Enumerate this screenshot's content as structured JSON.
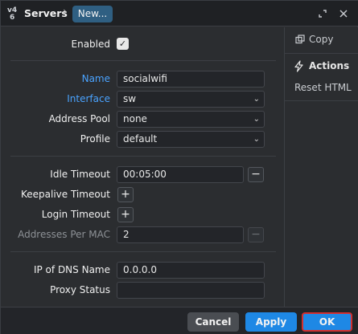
{
  "window": {
    "breadcrumb": "Servers",
    "breadcrumb_sep": "›",
    "current_tab": "New...",
    "logo_text": "v4"
  },
  "form": {
    "enabled_label": "Enabled",
    "enabled_checked": true,
    "name_label": "Name",
    "name_value": "socialwifi",
    "interface_label": "Interface",
    "interface_value": "sw",
    "address_pool_label": "Address Pool",
    "address_pool_value": "none",
    "profile_label": "Profile",
    "profile_value": "default",
    "idle_timeout_label": "Idle Timeout",
    "idle_timeout_value": "00:05:00",
    "keepalive_timeout_label": "Keepalive Timeout",
    "login_timeout_label": "Login Timeout",
    "addresses_per_mac_label": "Addresses Per MAC",
    "addresses_per_mac_value": "2",
    "ip_dns_label": "IP of DNS Name",
    "ip_dns_value": "0.0.0.0",
    "proxy_status_label": "Proxy Status",
    "proxy_status_value": ""
  },
  "side": {
    "copy_label": "Copy",
    "actions_label": "Actions",
    "reset_label": "Reset HTML"
  },
  "footer": {
    "cancel_label": "Cancel",
    "apply_label": "Apply",
    "ok_label": "OK"
  },
  "colors": {
    "accent_blue": "#1e88e5",
    "label_blue": "#4aa3ff",
    "ok_outline": "#d32f2f"
  }
}
